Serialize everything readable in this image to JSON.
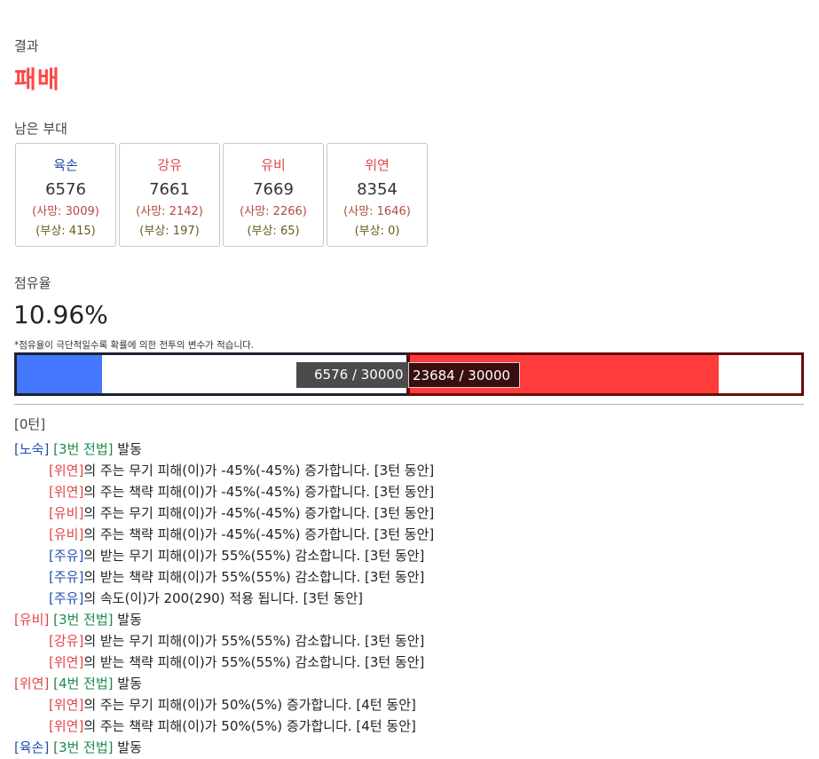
{
  "result": {
    "label": "결과",
    "value": "패배"
  },
  "remaining": {
    "label": "남은 부대",
    "units": [
      {
        "name": "육손",
        "color": "#1f4fb0",
        "count": "6576",
        "dead": "(사망: 3009)",
        "wounded": "(부상: 415)"
      },
      {
        "name": "강유",
        "color": "#e24545",
        "count": "7661",
        "dead": "(사망: 2142)",
        "wounded": "(부상: 197)"
      },
      {
        "name": "유비",
        "color": "#e24545",
        "count": "7669",
        "dead": "(사망: 2266)",
        "wounded": "(부상: 65)"
      },
      {
        "name": "위연",
        "color": "#e24545",
        "count": "8354",
        "dead": "(사망: 1646)",
        "wounded": "(부상: 0)"
      }
    ]
  },
  "occupancy": {
    "label": "점유율",
    "value": "10.96%",
    "note": "*점유율이 극단적일수록 확률에 의한 전투의 변수가 적습니다.",
    "left_text": "6576 / 30000",
    "right_text": "23684 / 30000",
    "left_fraction": 0.2192,
    "right_fraction": 0.7895
  },
  "log": {
    "turn_label": "[0턴]",
    "lines": [
      {
        "indent": false,
        "parts": [
          {
            "t": "[노숙]",
            "c": "blue"
          },
          {
            "t": " "
          },
          {
            "t": "[3번 전법]",
            "c": "green"
          },
          {
            "t": " 발동"
          }
        ]
      },
      {
        "indent": true,
        "parts": [
          {
            "t": "[위연]",
            "c": "red"
          },
          {
            "t": "의 주는 무기 피해(이)가 -45%(-45%) 증가합니다. [3턴 동안]"
          }
        ]
      },
      {
        "indent": true,
        "parts": [
          {
            "t": "[위연]",
            "c": "red"
          },
          {
            "t": "의 주는 책략 피해(이)가 -45%(-45%) 증가합니다. [3턴 동안]"
          }
        ]
      },
      {
        "indent": true,
        "parts": [
          {
            "t": "[유비]",
            "c": "red"
          },
          {
            "t": "의 주는 무기 피해(이)가 -45%(-45%) 증가합니다. [3턴 동안]"
          }
        ]
      },
      {
        "indent": true,
        "parts": [
          {
            "t": "[유비]",
            "c": "red"
          },
          {
            "t": "의 주는 책략 피해(이)가 -45%(-45%) 증가합니다. [3턴 동안]"
          }
        ]
      },
      {
        "indent": true,
        "parts": [
          {
            "t": "[주유]",
            "c": "blue"
          },
          {
            "t": "의 받는 무기 피해(이)가 55%(55%) 감소합니다. [3턴 동안]"
          }
        ]
      },
      {
        "indent": true,
        "parts": [
          {
            "t": "[주유]",
            "c": "blue"
          },
          {
            "t": "의 받는 책략 피해(이)가 55%(55%) 감소합니다. [3턴 동안]"
          }
        ]
      },
      {
        "indent": true,
        "parts": [
          {
            "t": "[주유]",
            "c": "blue"
          },
          {
            "t": "의 속도(이)가 200(290) 적용 됩니다. [3턴 동안]"
          }
        ]
      },
      {
        "indent": false,
        "parts": [
          {
            "t": "[유비]",
            "c": "red"
          },
          {
            "t": " "
          },
          {
            "t": "[3번 전법]",
            "c": "green"
          },
          {
            "t": " 발동"
          }
        ]
      },
      {
        "indent": true,
        "parts": [
          {
            "t": "[강유]",
            "c": "red"
          },
          {
            "t": "의 받는 무기 피해(이)가 55%(55%) 감소합니다. [3턴 동안]"
          }
        ]
      },
      {
        "indent": true,
        "parts": [
          {
            "t": "[위연]",
            "c": "red"
          },
          {
            "t": "의 받는 책략 피해(이)가 55%(55%) 감소합니다. [3턴 동안]"
          }
        ]
      },
      {
        "indent": false,
        "parts": [
          {
            "t": "[위연]",
            "c": "red"
          },
          {
            "t": " "
          },
          {
            "t": "[4번 전법]",
            "c": "green"
          },
          {
            "t": " 발동"
          }
        ]
      },
      {
        "indent": true,
        "parts": [
          {
            "t": "[위연]",
            "c": "red"
          },
          {
            "t": "의 주는 무기 피해(이)가 50%(5%) 증가합니다. [4턴 동안]"
          }
        ]
      },
      {
        "indent": true,
        "parts": [
          {
            "t": "[위연]",
            "c": "red"
          },
          {
            "t": "의 주는 책략 피해(이)가 50%(5%) 증가합니다. [4턴 동안]"
          }
        ]
      },
      {
        "indent": false,
        "parts": [
          {
            "t": "[육손]",
            "c": "blue"
          },
          {
            "t": " "
          },
          {
            "t": "[3번 전법]",
            "c": "green"
          },
          {
            "t": " 발동"
          }
        ]
      }
    ]
  },
  "colors": {
    "defeat": "#ff4747",
    "ally": "#1f4fb0",
    "enemy": "#e24545",
    "skill": "#1b8a4a",
    "ally_bar": "#4677ff",
    "enemy_bar": "#ff3b3b"
  }
}
